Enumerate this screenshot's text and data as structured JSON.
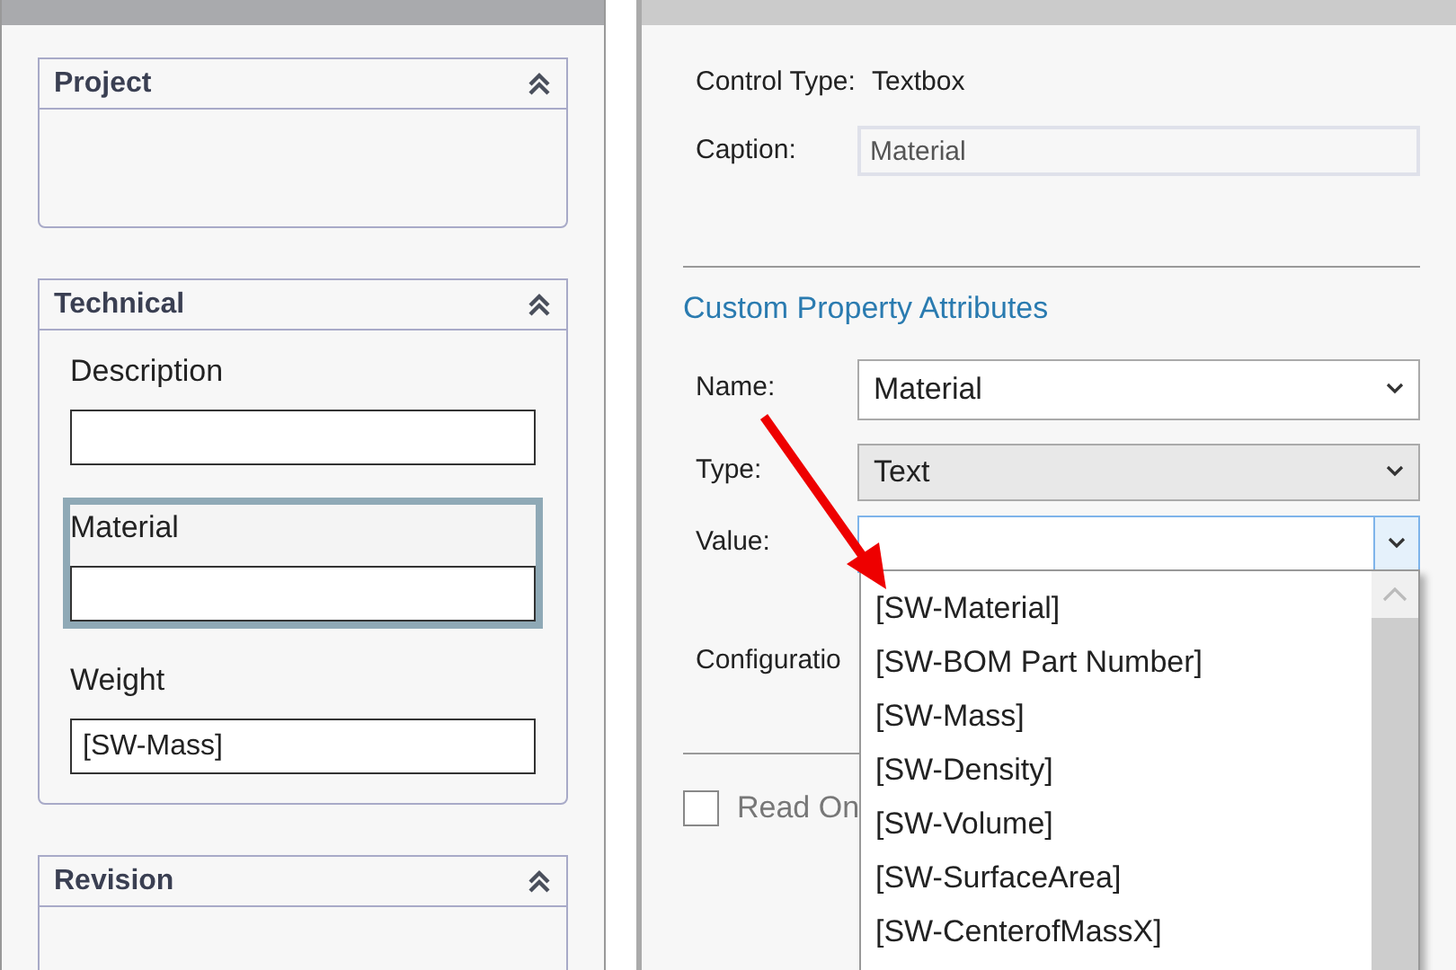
{
  "left_panel": {
    "groups": [
      {
        "title": "Project",
        "expanded": true
      },
      {
        "title": "Technical",
        "expanded": true,
        "fields": [
          {
            "label": "Description",
            "selected": false
          },
          {
            "label": "Material",
            "selected": true
          },
          {
            "label": "Weight",
            "value": "[SW-Mass]",
            "selected": false
          }
        ]
      },
      {
        "title": "Revision",
        "expanded": true
      }
    ]
  },
  "right_panel": {
    "control_type_label": "Control Type:",
    "control_type_value": "Textbox",
    "caption_label": "Caption:",
    "caption_value": "Material",
    "section_title": "Custom Property Attributes",
    "name_label": "Name:",
    "name_value": "Material",
    "type_label": "Type:",
    "type_value": "Text",
    "value_label": "Value:",
    "configuration_label": "Configuratio",
    "read_only": {
      "label": "Read On",
      "checked": false
    },
    "dropdown_options": [
      {
        "label": "[SW-Material]",
        "selected": false
      },
      {
        "label": "[SW-BOM Part Number]",
        "selected": false
      },
      {
        "label": "[SW-Mass]",
        "selected": false
      },
      {
        "label": "[SW-Density]",
        "selected": false
      },
      {
        "label": "[SW-Volume]",
        "selected": false
      },
      {
        "label": "[SW-SurfaceArea]",
        "selected": false
      },
      {
        "label": "[SW-CenterofMassX]",
        "selected": false
      }
    ]
  }
}
